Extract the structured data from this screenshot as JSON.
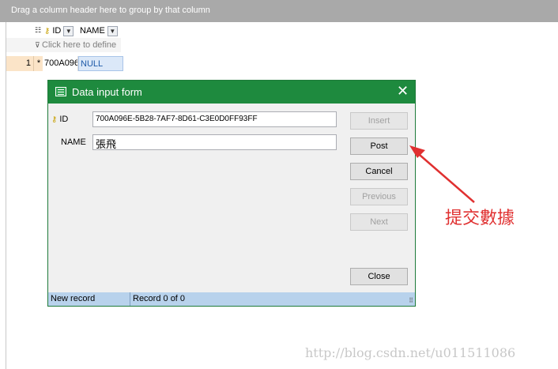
{
  "grid": {
    "group_panel_text": "Drag a column header here to group by that column",
    "columns": [
      {
        "label": "ID"
      },
      {
        "label": "NAME"
      }
    ],
    "filter_placeholder": "Click here to define",
    "row": {
      "number": "1",
      "indicator": "*",
      "id": "700A096",
      "name": "NULL"
    }
  },
  "dialog": {
    "title": "Data input form",
    "fields": {
      "id_label": "ID",
      "id_value": "700A096E-5B28-7AF7-8D61-C3E0D0FF93FF",
      "name_label": "NAME",
      "name_value": "張飛"
    },
    "buttons": {
      "insert": "Insert",
      "post": "Post",
      "cancel": "Cancel",
      "previous": "Previous",
      "next": "Next",
      "close": "Close"
    },
    "status": {
      "left": "New record",
      "right": "Record 0 of 0"
    }
  },
  "annotation": "提交數據",
  "watermark": "http://blog.csdn.net/u011511086",
  "colors": {
    "title_bar": "#1e8a3e",
    "annotation": "#e03030"
  }
}
